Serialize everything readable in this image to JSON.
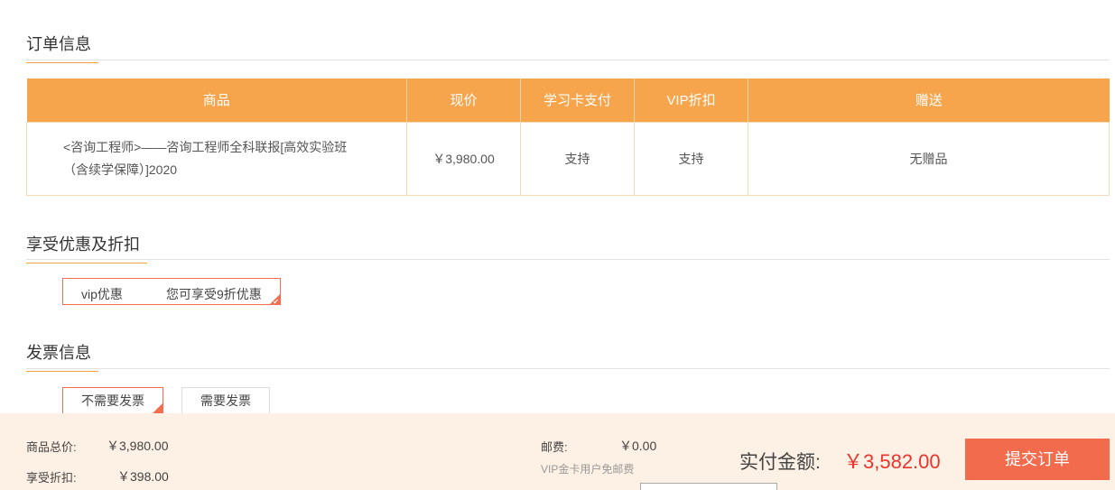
{
  "sections": {
    "order_title": "订单信息",
    "discount_title": "享受优惠及折扣",
    "invoice_title": "发票信息"
  },
  "order_table": {
    "headers": [
      "商品",
      "现价",
      "学习卡支付",
      "VIP折扣",
      "赠送"
    ],
    "rows": [
      {
        "product": "<咨询工程师>——咨询工程师全科联报[高效实验班（含续学保障）]2020",
        "price": "￥3,980.00",
        "card_pay": "支持",
        "vip": "支持",
        "gift": "无赠品"
      }
    ]
  },
  "discount": {
    "name": "vip优惠",
    "desc": "您可享受9折优惠",
    "check_icon": "checkmark-icon"
  },
  "invoice": {
    "no_invoice": "不需要发票",
    "need_invoice": "需要发票"
  },
  "footer": {
    "total_label": "商品总价:",
    "total_value": "￥3,980.00",
    "discount_label": "享受折扣:",
    "discount_value": "￥398.00",
    "shipping_label": "邮费:",
    "shipping_value": "￥0.00",
    "shipping_note": "VIP金卡用户免邮费",
    "pay_label": "实付金额:",
    "pay_amount": "￥3,582.00",
    "submit_label": "提交订单"
  },
  "colors": {
    "accent": "#f7a54c",
    "selected_border": "#f26e4e",
    "price_red": "#e8352e",
    "submit_bg": "#f26b4c",
    "footer_bg": "#fdf0e4"
  }
}
